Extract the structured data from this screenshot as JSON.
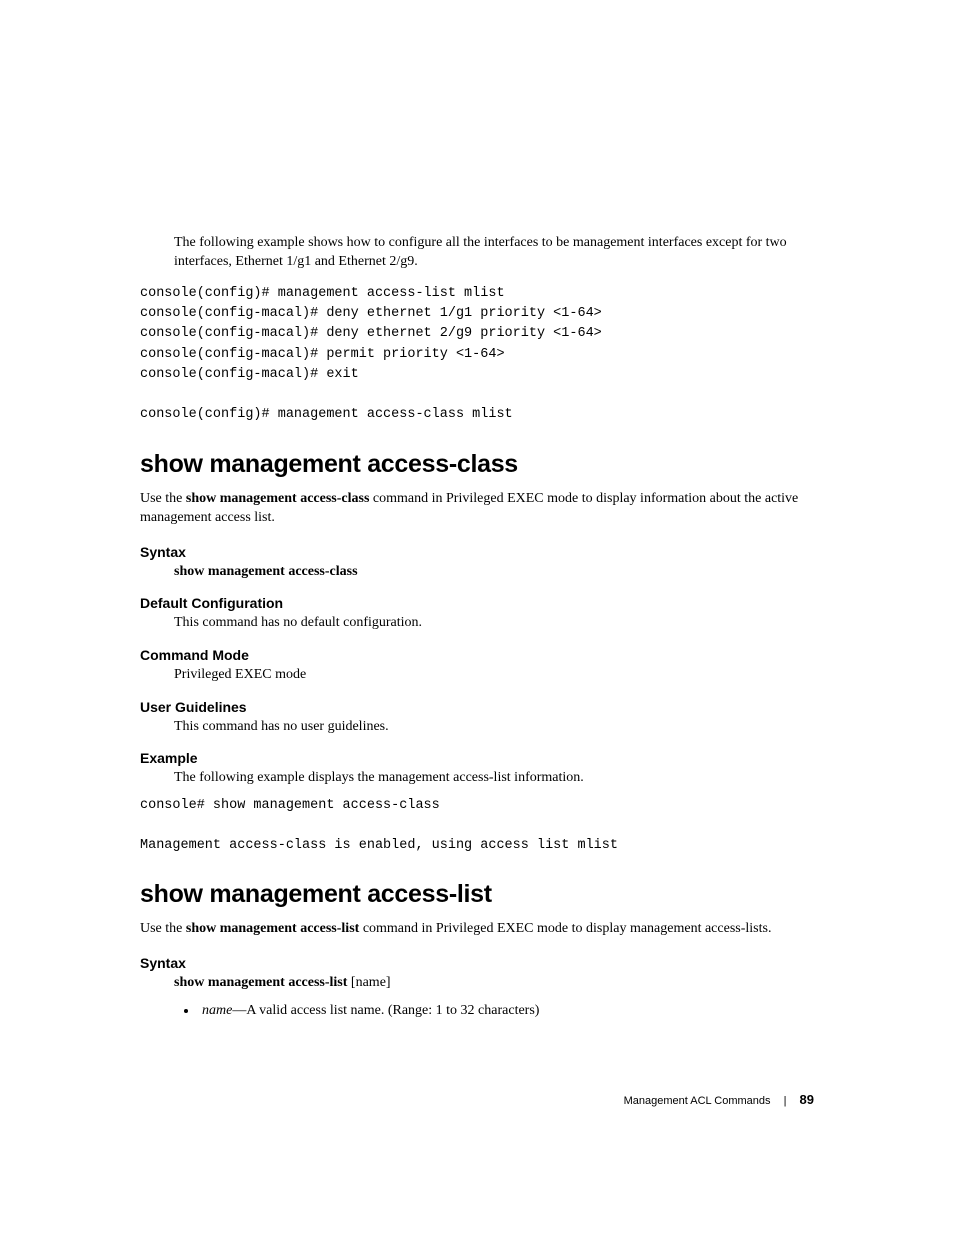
{
  "intro": "The following example shows how to configure all the interfaces to be management interfaces except for two interfaces, Ethernet 1/g1 and Ethernet 2/g9.",
  "code1": "console(config)# management access-list mlist\nconsole(config-macal)# deny ethernet 1/g1 priority <1-64>\nconsole(config-macal)# deny ethernet 2/g9 priority <1-64>\nconsole(config-macal)# permit priority <1-64>\nconsole(config-macal)# exit\n\nconsole(config)# management access-class mlist",
  "section1": {
    "heading": "show management access-class",
    "desc_pre": "Use the ",
    "desc_bold": "show management access-class",
    "desc_post": " command in Privileged EXEC mode to display information about the active management access list.",
    "syntax_label": "Syntax",
    "syntax_body": "show management access-class",
    "default_label": "Default Configuration",
    "default_body": "This command has no default configuration.",
    "mode_label": "Command Mode",
    "mode_body": "Privileged EXEC mode",
    "guidelines_label": "User Guidelines",
    "guidelines_body": "This command has no user guidelines.",
    "example_label": "Example",
    "example_body": "The following example displays the management access-list information.",
    "example_code": "console# show management access-class\n\nManagement access-class is enabled, using access list mlist"
  },
  "section2": {
    "heading": "show management access-list",
    "desc_pre": "Use the ",
    "desc_bold": "show management access-list",
    "desc_post": " command in Privileged EXEC mode to display management access-lists.",
    "syntax_label": "Syntax",
    "syntax_body_pre": "show management access-list ",
    "syntax_body_arg": "[name]",
    "bullet_name": "name",
    "bullet_rest": "—A valid access list name. (Range: 1 to 32 characters)"
  },
  "footer": {
    "title": "Management ACL Commands",
    "page": "89"
  }
}
